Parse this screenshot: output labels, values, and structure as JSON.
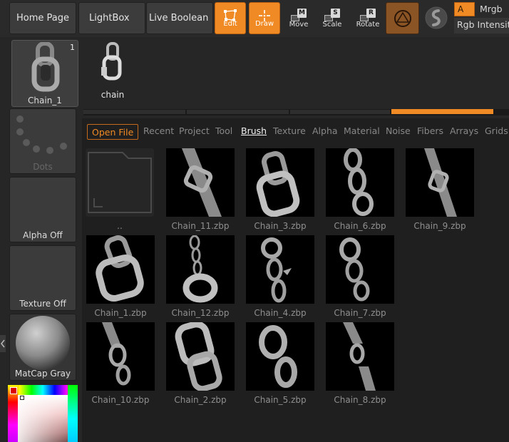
{
  "topbar": {
    "home_page": "Home Page",
    "lightbox": "LightBox",
    "live_boolean": "Live Boolean",
    "tools": [
      {
        "label": "Edit",
        "icon": "edit-icon",
        "active": true
      },
      {
        "label": "Draw",
        "icon": "draw-icon",
        "active": true
      },
      {
        "label": "Move",
        "icon": "move-icon",
        "key": "M"
      },
      {
        "label": "Scale",
        "icon": "scale-icon",
        "key": "S"
      },
      {
        "label": "Rotate",
        "icon": "rotate-icon",
        "key": "R"
      }
    ],
    "a_badge": "A",
    "mrgb": "Mrgb",
    "rgb_intensity": "Rgb Intensity"
  },
  "tool_palette": {
    "current_tool_label": "Chain_1",
    "count": "1",
    "tool_name": "chain"
  },
  "left": {
    "dots": "Dots",
    "alpha": "Alpha Off",
    "texture": "Texture Off",
    "matcap": "MatCap Gray"
  },
  "browser": {
    "open_file": "Open File",
    "tabs": [
      "Recent",
      "Project",
      "Tool",
      "Brush",
      "Texture",
      "Alpha",
      "Material",
      "Noise",
      "Fibers",
      "Arrays",
      "Grids"
    ],
    "active_tab": "Brush",
    "parent_folder": "..",
    "files": [
      "Chain_11.zbp",
      "Chain_3.zbp",
      "Chain_6.zbp",
      "Chain_9.zbp",
      "Chain_1.zbp",
      "Chain_12.zbp",
      "Chain_4.zbp",
      "Chain_7.zbp",
      "Chain_10.zbp",
      "Chain_2.zbp",
      "Chain_5.zbp",
      "Chain_8.zbp"
    ]
  },
  "colors": {
    "accent": "#f08a24",
    "panel_bg": "#1f1f1f",
    "button_bg": "#3c3c3c"
  }
}
